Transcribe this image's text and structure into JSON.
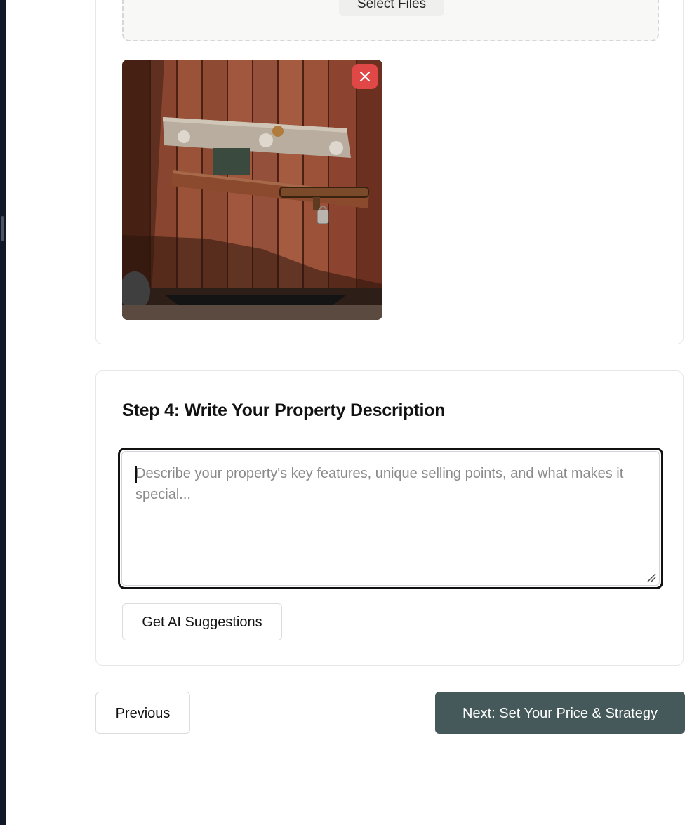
{
  "upload": {
    "select_files_label": "Select Files"
  },
  "photo": {
    "remove_icon": "close-icon"
  },
  "description": {
    "title": "Step 4: Write Your Property Description",
    "placeholder": "Describe your property's key features, unique selling points, and what makes it special...",
    "ai_button_label": "Get AI Suggestions"
  },
  "navigation": {
    "previous_label": "Previous",
    "next_label": "Next: Set Your Price & Strategy"
  },
  "colors": {
    "primary_button": "#45595a",
    "remove_button": "#e04848"
  }
}
